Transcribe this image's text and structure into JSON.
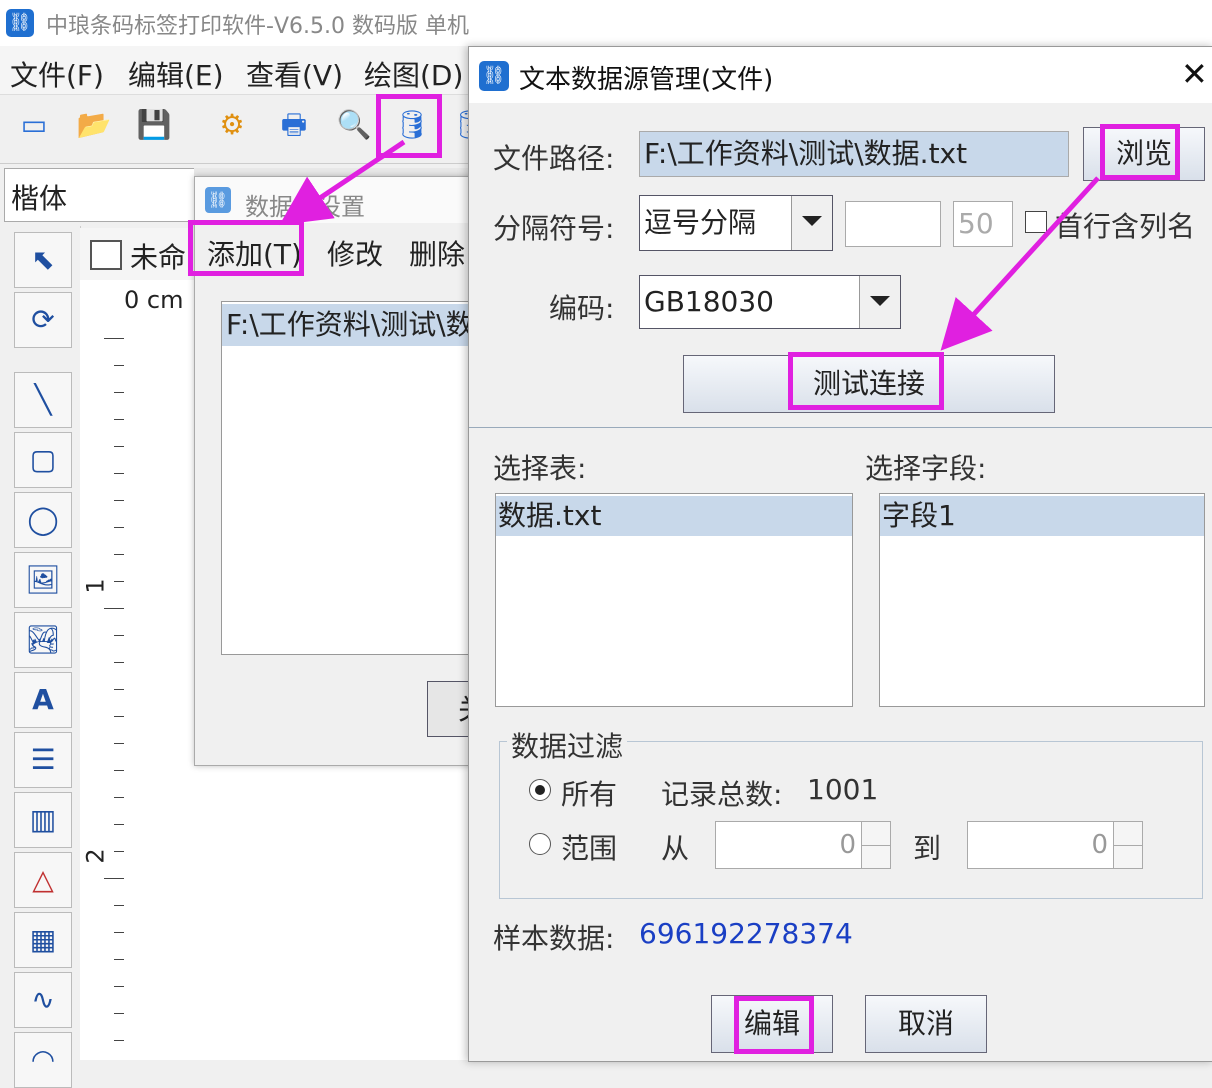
{
  "app": {
    "title": "中琅条码标签打印软件-V6.5.0 数码版 单机",
    "menu": [
      "文件(F)",
      "编辑(E)",
      "查看(V)",
      "绘图(D)"
    ],
    "font_name": "楷体",
    "doc_tab": "未命"
  },
  "ruler": {
    "unit": "0 cm",
    "marks": [
      "1",
      "2"
    ]
  },
  "ds_dialog": {
    "title": "数据库设置",
    "buttons": {
      "add": "添加(T)",
      "modify": "修改",
      "delete": "删除",
      "close": "关"
    },
    "list_items": [
      "F:\\工作资料\\测试\\数"
    ]
  },
  "tx_dialog": {
    "title": "文本数据源管理(文件)",
    "close": "✕",
    "file_path_label": "文件路径:",
    "file_path_value": "F:\\工作资料\\测试\\数据.txt",
    "browse": "浏览",
    "separator_label": "分隔符号:",
    "separator_value": "逗号分隔",
    "separator_custom": "",
    "separator_number": "50",
    "first_row_header": "首行含列名",
    "encoding_label": "编码:",
    "encoding_value": "GB18030",
    "test_button": "测试连接",
    "select_table_label": "选择表:",
    "tables": [
      "数据.txt"
    ],
    "select_field_label": "选择字段:",
    "fields": [
      "字段1"
    ],
    "filter_title": "数据过滤",
    "filter_all": "所有",
    "record_total_label": "记录总数:",
    "record_total": "1001",
    "filter_range": "范围",
    "from_label": "从",
    "from_value": "0",
    "to_label": "到",
    "to_value": "0",
    "sample_label": "样本数据:",
    "sample_value": "696192278374",
    "edit_button": "编辑",
    "cancel_button": "取消"
  },
  "colors": {
    "highlight": "#e020e0",
    "selection": "#c8d8ea",
    "sample": "#1a3fc4"
  }
}
